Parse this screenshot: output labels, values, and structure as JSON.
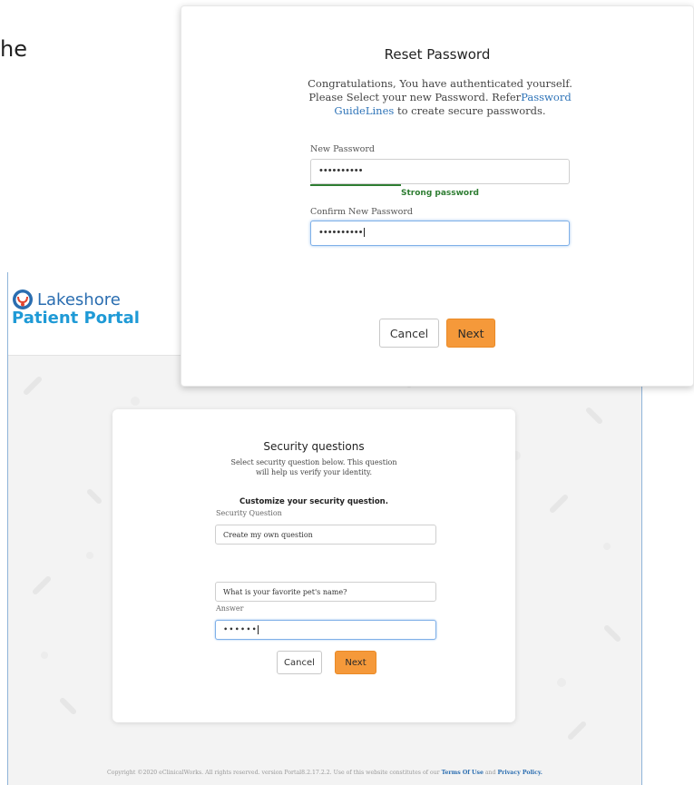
{
  "stray_text": "he",
  "portal": {
    "logo_line1": "Lakeshore",
    "logo_line2": "Patient Portal",
    "security_card": {
      "title": "Security questions",
      "description": "Select security question below. This question will help us verify your identity.",
      "customize_heading": "Customize your security question.",
      "question_label": "Security Question",
      "question_select_value": "Create my own question",
      "custom_question_value": "What is your favorite pet's name?",
      "answer_label": "Answer",
      "answer_value": "••••••",
      "cancel_label": "Cancel",
      "next_label": "Next"
    },
    "copyright_text": "Copyright ©2020 eClinicalWorks. All rights reserved. version Portal8.2.17.2.2.  Use of this website constitutes of our",
    "terms_link": "Terms Of Use",
    "and_text": "and",
    "privacy_link": "Privacy Policy."
  },
  "reset_password": {
    "title": "Reset Password",
    "message_line1": "Congratulations, You have authenticated yourself. Please Select your new Password. Refer",
    "guidelines_link": "Password GuideLines",
    "message_line2": " to create secure passwords.",
    "new_password_label": "New Password",
    "new_password_value": "••••••••••",
    "strength_text": "Strong password",
    "strength_fraction": 0.35,
    "confirm_password_label": "Confirm New Password",
    "confirm_password_value": "••••••••••",
    "cancel_label": "Cancel",
    "next_label": "Next"
  },
  "colors": {
    "accent_orange": "#f5993a",
    "link_blue": "#2f74b8",
    "strength_green": "#2e7d32",
    "focus_blue": "#7fb0e8"
  }
}
